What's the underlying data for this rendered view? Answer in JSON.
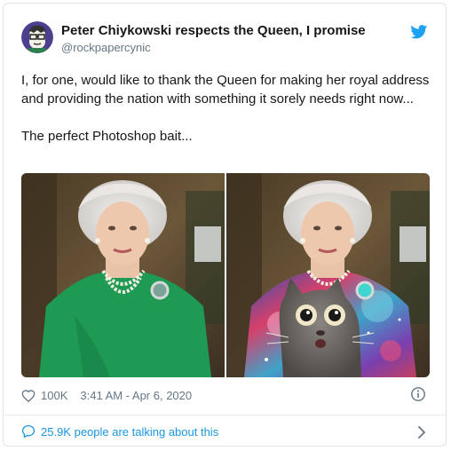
{
  "author": {
    "name": "Peter Chiykowski respects the Queen, I promise",
    "handle": "@rockpapercynic"
  },
  "tweet": {
    "paragraph1": "I, for one, would like to thank the Queen for making her royal address and providing the nation with something it sorely needs right now...",
    "paragraph2": "The perfect Photoshop bait..."
  },
  "meta": {
    "likes": "100K",
    "timestamp": "3:41 AM - Apr 6, 2020"
  },
  "footer": {
    "talking": "25.9K people are talking about this"
  },
  "icons": [
    "avatar",
    "twitter-bird-icon",
    "heart-icon",
    "info-icon",
    "comment-bubble-icon",
    "chevron-right-icon"
  ],
  "colors": {
    "accent": "#1b95e0",
    "twitter_blue": "#1da1f2",
    "muted": "#657786",
    "text": "#14171a"
  }
}
